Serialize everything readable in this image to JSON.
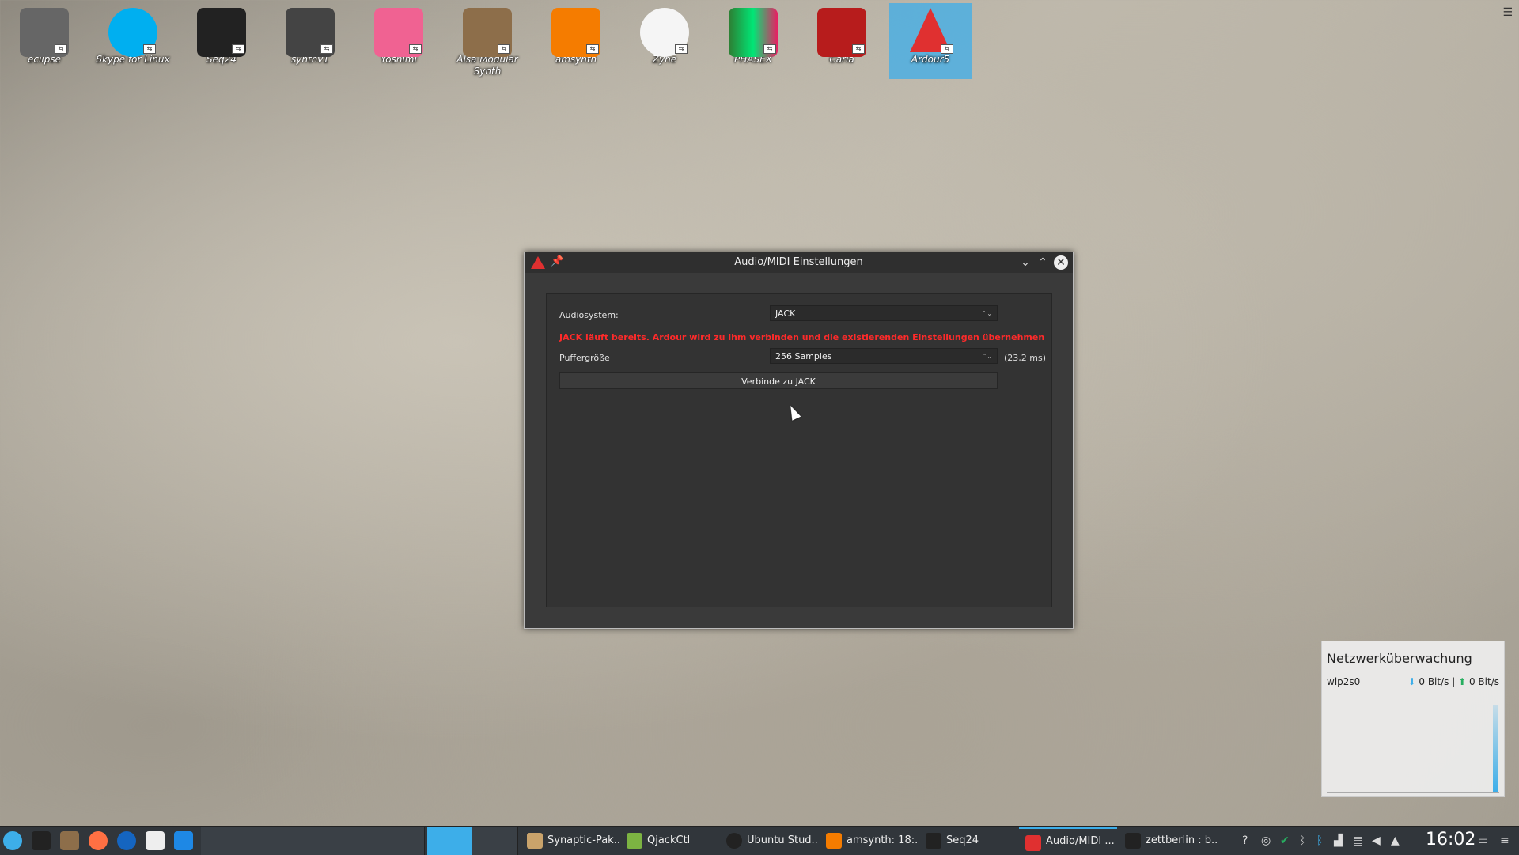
{
  "desktop": {
    "icons": [
      {
        "label": "eclipse",
        "icon": "eclipse-icon",
        "color": "#666666"
      },
      {
        "label": "Skype for Linux",
        "icon": "skype-icon",
        "color": "#00aff0"
      },
      {
        "label": "Seq24",
        "icon": "seq24-icon",
        "color": "#222222"
      },
      {
        "label": "synthv1",
        "icon": "synthv1-icon",
        "color": "#444444"
      },
      {
        "label": "Yoshimi",
        "icon": "yoshimi-icon",
        "color": "#f06292"
      },
      {
        "label": "Alsa Modular Synth",
        "icon": "ams-icon",
        "color": "#8d6e4a"
      },
      {
        "label": "amsynth",
        "icon": "amsynth-icon",
        "color": "#f57c00"
      },
      {
        "label": "Zyne",
        "icon": "zyne-icon",
        "color": "#f5f5f5"
      },
      {
        "label": "PHASEX",
        "icon": "phasex-icon",
        "color": "#2e7d32"
      },
      {
        "label": "Carla",
        "icon": "carla-icon",
        "color": "#b71c1c"
      },
      {
        "label": "Ardour5",
        "icon": "ardour-icon",
        "color": "#e03030"
      }
    ],
    "menu_glyph": "☰"
  },
  "dialog": {
    "title": "Audio/MIDI Einstellungen",
    "audiosystem_label": "Audiosystem:",
    "audiosystem_value": "JACK",
    "warning": "JACK läuft bereits. Ardour wird zu ihm verbinden und die existierenden Einstellungen übernehmen",
    "buffer_label": "Puffergröße",
    "buffer_value": "256 Samples",
    "latency": "(23,2 ms)",
    "connect_button": "Verbinde zu JACK",
    "minimize_glyph": "⌄",
    "maximize_glyph": "⌃",
    "close_glyph": "✕",
    "pin_glyph": "📌",
    "combo_arrows": "⌃⌄"
  },
  "network_widget": {
    "title": "Netzwerküberwachung",
    "interface": "wlp2s0",
    "down_rate": "0 Bit/s",
    "up_rate": "0 Bit/s",
    "separator": "|",
    "down_arrow": "⬇",
    "up_arrow": "⬆"
  },
  "taskbar": {
    "tasks": [
      {
        "label": "Synaptic-Pak...",
        "color": "#c9a36b"
      },
      {
        "label": "QjackCtl",
        "color": "#7cb342"
      },
      {
        "label": "Ubuntu Stud...",
        "color": "#222222"
      },
      {
        "label": "amsynth: 18:...",
        "color": "#f57c00"
      },
      {
        "label": "Seq24",
        "color": "#222222"
      },
      {
        "label": "Audio/MIDI ...",
        "color": "#e03030"
      },
      {
        "label": "zettberlin : b...",
        "color": "#222222"
      }
    ],
    "clock": "16:02"
  }
}
